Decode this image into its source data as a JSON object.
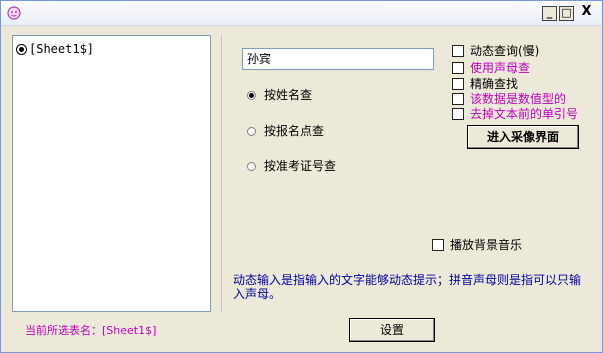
{
  "window": {
    "min_label": "_",
    "max_label": "□",
    "close_label": "X"
  },
  "tree": {
    "item": "[Sheet1$]"
  },
  "search": {
    "value": "孙宾"
  },
  "options": [
    {
      "label": "按姓名查",
      "selected": true
    },
    {
      "label": "按报名点查",
      "selected": false
    },
    {
      "label": "按准考证号查",
      "selected": false
    }
  ],
  "checkboxes": [
    {
      "label": "动态查询(慢)",
      "color": "#000000"
    },
    {
      "label": "使用声母查",
      "color": "#c000c0"
    },
    {
      "label": "精确查找",
      "color": "#000000"
    },
    {
      "label": "该数据是数值型的",
      "color": "#c000c0"
    },
    {
      "label": "去掉文本前的单引号",
      "color": "#c000c0"
    }
  ],
  "buttons": {
    "collect": "进入采像界面",
    "settings": "设置"
  },
  "music": {
    "label": "播放背景音乐"
  },
  "hint": "动态输入是指输入的文字能够动态提示；拼音声母则是指可以只输入声母。",
  "status": {
    "text": "当前所选表名：[Sheet1$]"
  }
}
